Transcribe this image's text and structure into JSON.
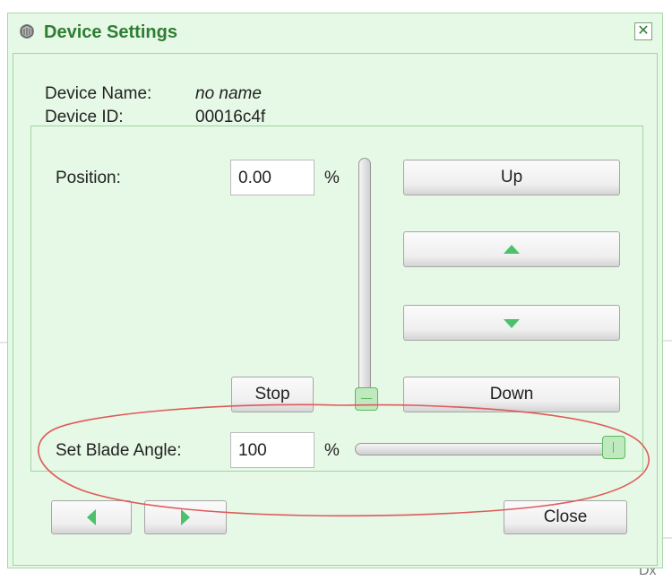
{
  "background": {
    "corner_text": "Dx"
  },
  "dialog": {
    "title": "Device Settings",
    "close_glyph": "✕",
    "title_icon": "device-icon",
    "accent_color": "#2e7d32",
    "panel_color": "#e6f8e6"
  },
  "device": {
    "name_label": "Device Name:",
    "name_value": "no name",
    "id_label": "Device ID:",
    "id_value": "00016c4f"
  },
  "position": {
    "label": "Position:",
    "value": "0.00",
    "unit": "%",
    "slider_value_percent": 0
  },
  "blade_angle": {
    "label": "Set Blade Angle:",
    "value": "100",
    "unit": "%",
    "slider_value_percent": 100
  },
  "buttons": {
    "up": "Up",
    "step_up_icon": "triangle-up-icon",
    "step_down_icon": "triangle-down-icon",
    "down": "Down",
    "stop": "Stop",
    "prev_icon": "triangle-left-icon",
    "next_icon": "triangle-right-icon",
    "close": "Close"
  },
  "annotation": {
    "shape": "ellipse",
    "color": "#e05a5a"
  }
}
